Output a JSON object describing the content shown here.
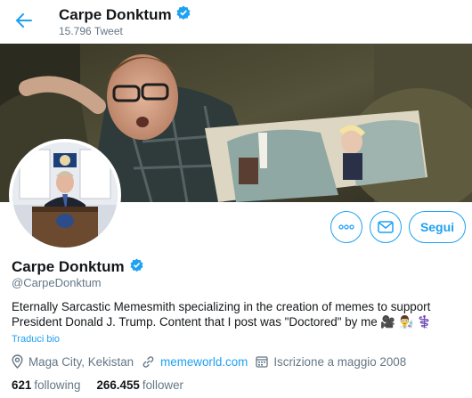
{
  "header": {
    "name": "Carpe Donktum",
    "tweet_count": "15.796 Tweet"
  },
  "profile": {
    "name": "Carpe Donktum",
    "handle": "@CarpeDonktum",
    "bio": "Eternally Sarcastic Memesmith specializing in the creation of memes to support President Donald J. Trump. Content that I post was \"Doctored\" by me 🎥 👨‍🔬 ⚕️",
    "translate_label": "Traduci bio",
    "location": "Maga City, Kekistan",
    "website": "memeworld.com",
    "joined": "Iscrizione a maggio 2008",
    "following_count": "621",
    "following_label": "following",
    "follower_count": "266.455",
    "follower_label": "follower"
  },
  "actions": {
    "follow_label": "Segui",
    "more_icon": "more-icon",
    "message_icon": "envelope-icon"
  },
  "colors": {
    "accent": "#1da1f2",
    "secondary_text": "#657786"
  }
}
